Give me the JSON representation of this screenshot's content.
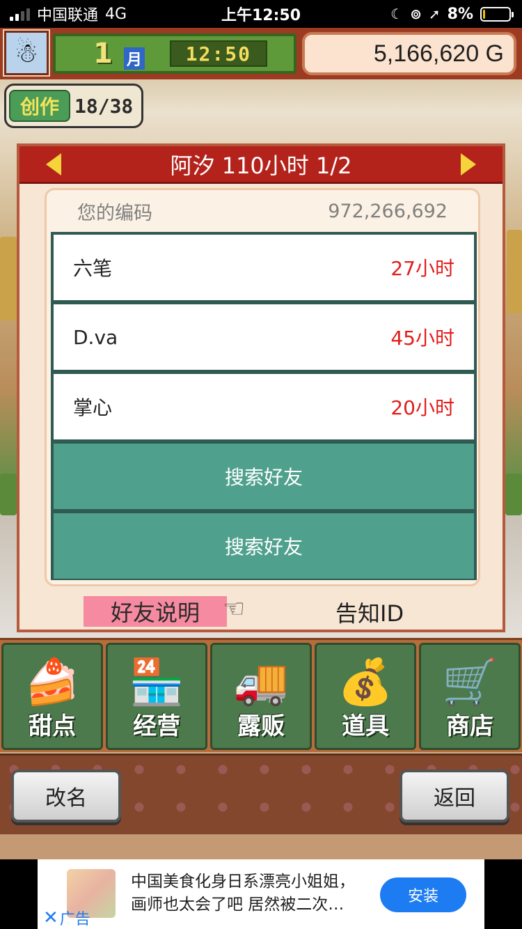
{
  "status_bar": {
    "carrier": "中国联通",
    "network": "4G",
    "time": "上午12:50",
    "battery": "8%",
    "battery_level": 0.08
  },
  "hud": {
    "month": "1",
    "month_unit": "月",
    "clock": "12:50",
    "money": "5,166,620 G"
  },
  "creation": {
    "label": "创作",
    "count": "18/38"
  },
  "dialog": {
    "title": "阿汐  110小时 1/2",
    "code_label": "您的编码",
    "code_value": "972,266,692",
    "friends": [
      {
        "name": "六笔",
        "hours": "27小时"
      },
      {
        "name": "D.va",
        "hours": "45小时"
      },
      {
        "name": "掌心",
        "hours": "20小时"
      }
    ],
    "search_buttons": [
      "搜索好友",
      "搜索好友"
    ],
    "help_label": "好友说明",
    "notify_label": "告知ID"
  },
  "menu": {
    "items": [
      {
        "label": "甜点",
        "icon": "cake-icon",
        "glyph": "🍰"
      },
      {
        "label": "经营",
        "icon": "shop-building-icon",
        "glyph": "🏪"
      },
      {
        "label": "露贩",
        "icon": "food-truck-icon",
        "glyph": "🚚"
      },
      {
        "label": "道具",
        "icon": "items-bag-icon",
        "glyph": "💰"
      },
      {
        "label": "商店",
        "icon": "shopping-cart-icon",
        "glyph": "🛒"
      }
    ]
  },
  "bottom_bar": {
    "rename_label": "改名",
    "back_label": "返回"
  },
  "ad": {
    "line1": "中国美食化身日系漂亮小姐姐，",
    "line2": "画师也太会了吧 居然被二次…",
    "install_label": "安装",
    "ad_tag": "广告"
  },
  "colors": {
    "header_red": "#b3231c",
    "list_teal": "#4fa08d",
    "hours_red": "#e11d1d",
    "help_pink": "#f58aa0",
    "install_blue": "#1e7cf2"
  }
}
